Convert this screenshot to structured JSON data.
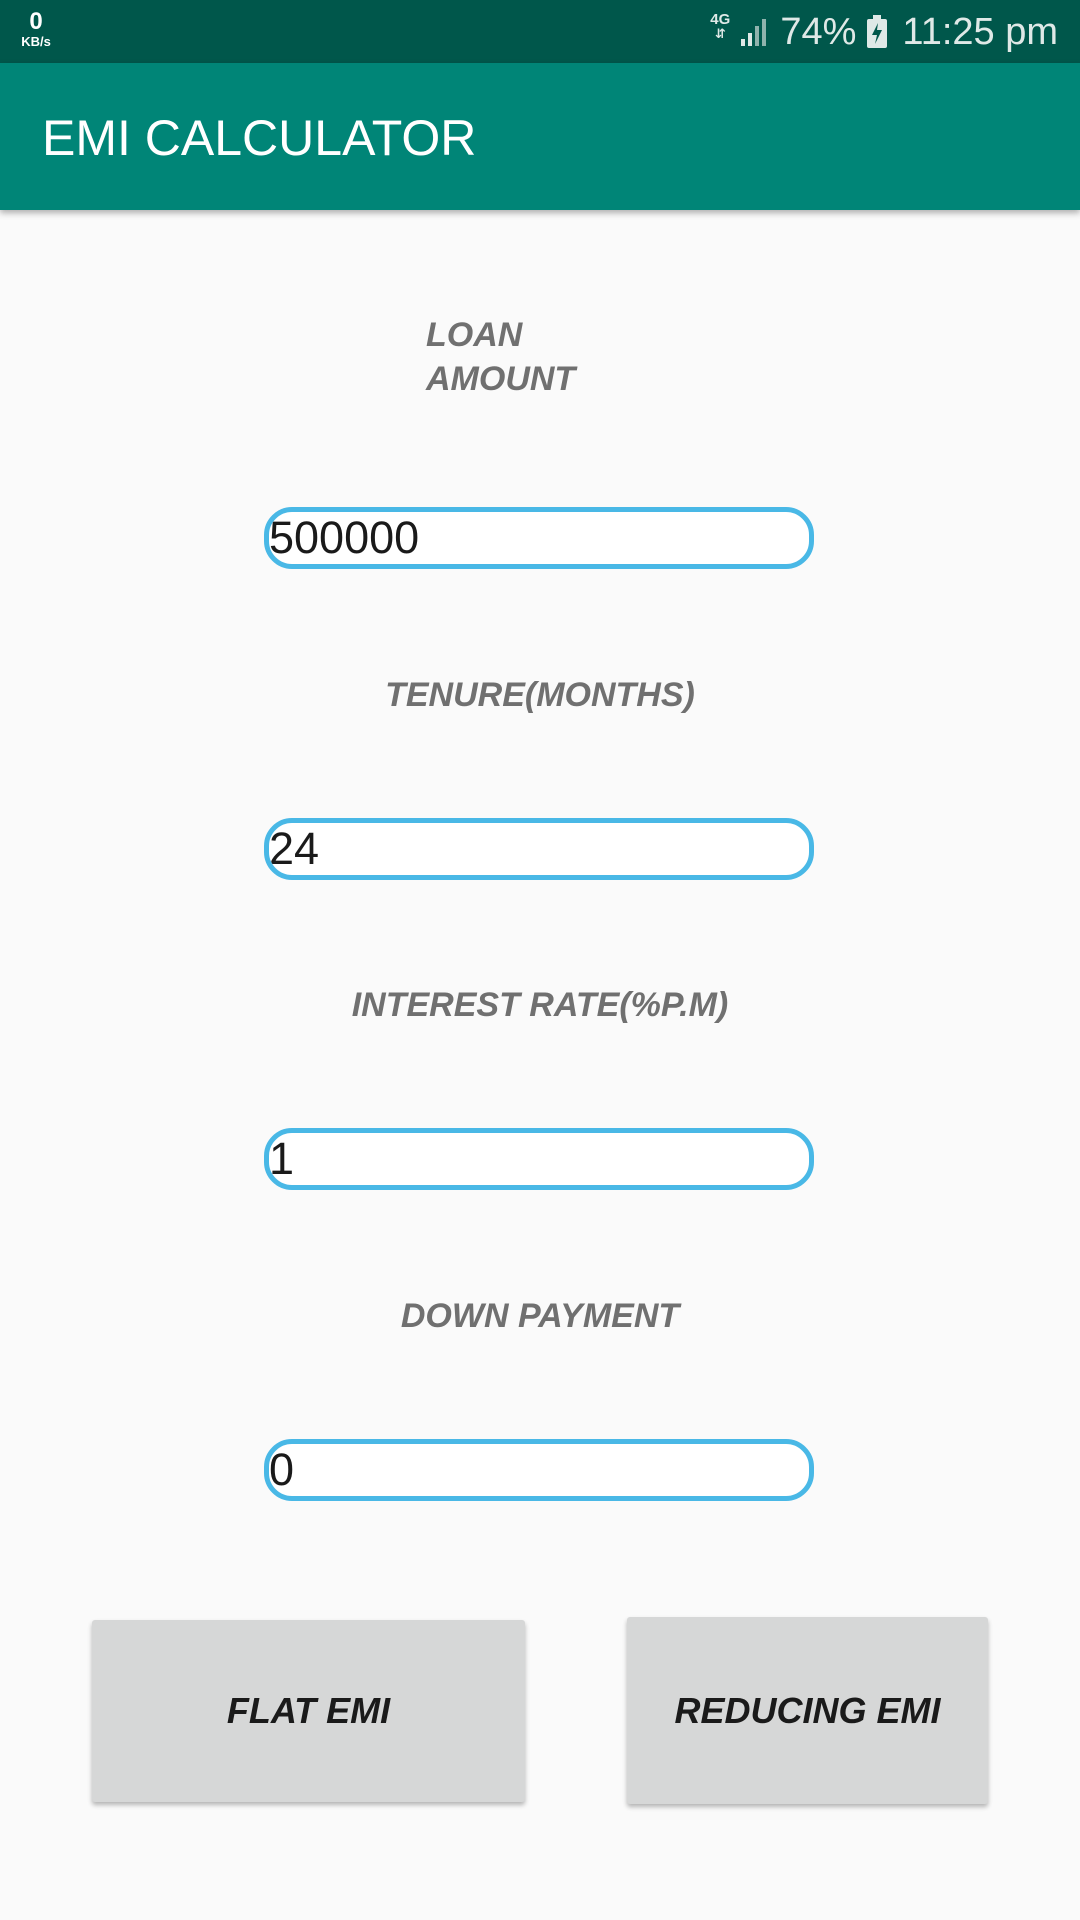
{
  "status_bar": {
    "net_speed_value": "0",
    "net_speed_unit": "KB/s",
    "network_type": "4G",
    "network_arrows": "⇵",
    "signal_icon": "signal-bars-icon",
    "battery_percent": "74%",
    "battery_icon": "battery-charging-icon",
    "time": "11:25 pm"
  },
  "app_bar": {
    "title": "EMI CALCULATOR",
    "color": "#008577"
  },
  "form": {
    "loan_amount_label": "LOAN AMOUNT",
    "loan_amount_value": "500000",
    "tenure_label": "TENURE(MONTHS)",
    "tenure_value": "24",
    "interest_label": "INTEREST RATE(%P.M)",
    "interest_value": "1",
    "down_payment_label": "DOWN PAYMENT",
    "down_payment_value": "0"
  },
  "buttons": {
    "flat_emi": "FLAT EMI",
    "reducing_emi": "REDUCING EMI"
  },
  "colors": {
    "status_bar": "#00574b",
    "input_border": "#49b8e6",
    "button_bg": "#d6d7d7",
    "label_text": "#707070"
  }
}
